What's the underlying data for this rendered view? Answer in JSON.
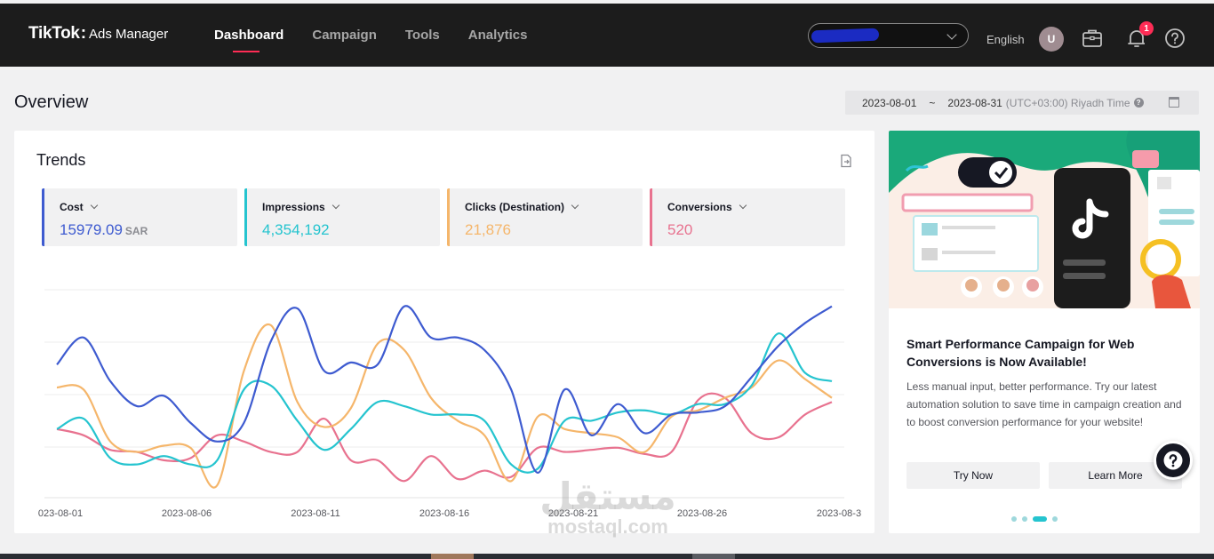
{
  "header": {
    "logo_brand": "TikTok",
    "logo_colon": ":",
    "logo_product": "Ads Manager",
    "nav": [
      {
        "label": "Dashboard",
        "active": true
      },
      {
        "label": "Campaign",
        "active": false
      },
      {
        "label": "Tools",
        "active": false
      },
      {
        "label": "Analytics",
        "active": false
      }
    ],
    "account_selector_icon": "chevron-down-icon",
    "language": "English",
    "avatar_initial": "U",
    "notification_count": "1",
    "icons": [
      "briefcase-icon",
      "bell-icon",
      "help-circle-icon"
    ]
  },
  "overview": {
    "title": "Overview",
    "date_start": "2023-08-01",
    "date_sep": "~",
    "date_end": "2023-08-31",
    "timezone": "(UTC+03:00) Riyadh Time",
    "help_mark": "?"
  },
  "trends": {
    "title": "Trends",
    "metrics": [
      {
        "label": "Cost",
        "value": "15979.09",
        "unit": "SAR",
        "color": "#3e5bd0"
      },
      {
        "label": "Impressions",
        "value": "4,354,192",
        "unit": "",
        "color": "#25c4cf"
      },
      {
        "label": "Clicks (Destination)",
        "value": "21,876",
        "unit": "",
        "color": "#f5b66b"
      },
      {
        "label": "Conversions",
        "value": "520",
        "unit": "",
        "color": "#e8728f"
      }
    ],
    "x_tick_labels": [
      "023-08-01",
      "2023-08-06",
      "2023-08-11",
      "2023-08-16",
      "2023-08-21",
      "2023-08-26",
      "2023-08-3"
    ]
  },
  "chart_data": {
    "type": "line",
    "title": "",
    "xlabel": "",
    "ylabel": "",
    "grid": true,
    "y_axis_labels_shown": false,
    "x": [
      "2023-08-01",
      "2023-08-02",
      "2023-08-03",
      "2023-08-04",
      "2023-08-05",
      "2023-08-06",
      "2023-08-07",
      "2023-08-08",
      "2023-08-09",
      "2023-08-10",
      "2023-08-11",
      "2023-08-12",
      "2023-08-13",
      "2023-08-14",
      "2023-08-15",
      "2023-08-16",
      "2023-08-17",
      "2023-08-18",
      "2023-08-19",
      "2023-08-20",
      "2023-08-21",
      "2023-08-22",
      "2023-08-23",
      "2023-08-24",
      "2023-08-25",
      "2023-08-26",
      "2023-08-27",
      "2023-08-28",
      "2023-08-29",
      "2023-08-30",
      "2023-08-31"
    ],
    "series": [
      {
        "name": "Cost",
        "color": "#3e5bd0",
        "values": [
          0.64,
          0.77,
          0.56,
          0.44,
          0.49,
          0.36,
          0.27,
          0.36,
          0.75,
          0.91,
          0.61,
          0.65,
          0.64,
          0.92,
          0.77,
          0.77,
          0.71,
          0.52,
          0.12,
          0.52,
          0.3,
          0.45,
          0.31,
          0.4,
          0.41,
          0.44,
          0.58,
          0.73,
          0.84,
          0.92
        ]
      },
      {
        "name": "Impressions",
        "color": "#25c4cf",
        "values": [
          0.33,
          0.38,
          0.19,
          0.16,
          0.2,
          0.16,
          0.18,
          0.52,
          0.54,
          0.37,
          0.23,
          0.33,
          0.46,
          0.44,
          0.4,
          0.4,
          0.37,
          0.16,
          0.14,
          0.37,
          0.37,
          0.41,
          0.42,
          0.4,
          0.45,
          0.45,
          0.54,
          0.79,
          0.6,
          0.56
        ]
      },
      {
        "name": "Clicks (Destination)",
        "color": "#f5b66b",
        "values": [
          0.53,
          0.52,
          0.27,
          0.22,
          0.25,
          0.24,
          0.06,
          0.61,
          0.83,
          0.46,
          0.34,
          0.43,
          0.74,
          0.71,
          0.48,
          0.37,
          0.3,
          0.08,
          0.39,
          0.33,
          0.31,
          0.29,
          0.22,
          0.39,
          0.42,
          0.48,
          0.53,
          0.66,
          0.57,
          0.48
        ]
      },
      {
        "name": "Conversions",
        "color": "#e8728f",
        "values": [
          0.33,
          0.3,
          0.23,
          0.22,
          0.18,
          0.19,
          0.3,
          0.27,
          0.22,
          0.22,
          0.38,
          0.18,
          0.18,
          0.08,
          0.2,
          0.09,
          0.13,
          0.1,
          0.24,
          0.22,
          0.23,
          0.24,
          0.21,
          0.22,
          0.47,
          0.48,
          0.31,
          0.29,
          0.4,
          0.46
        ]
      }
    ]
  },
  "promo": {
    "title": "Smart Performance Campaign for Web Conversions is Now Available!",
    "description": "Less manual input, better performance. Try our latest automation solution to save time in campaign creation and to boost conversion performance for your website!",
    "try_now": "Try Now",
    "learn_more": "Learn More",
    "carousel_pages": 5,
    "carousel_active": 2
  },
  "watermark": {
    "arabic": "مستقل",
    "latin": "mostaql.com"
  }
}
